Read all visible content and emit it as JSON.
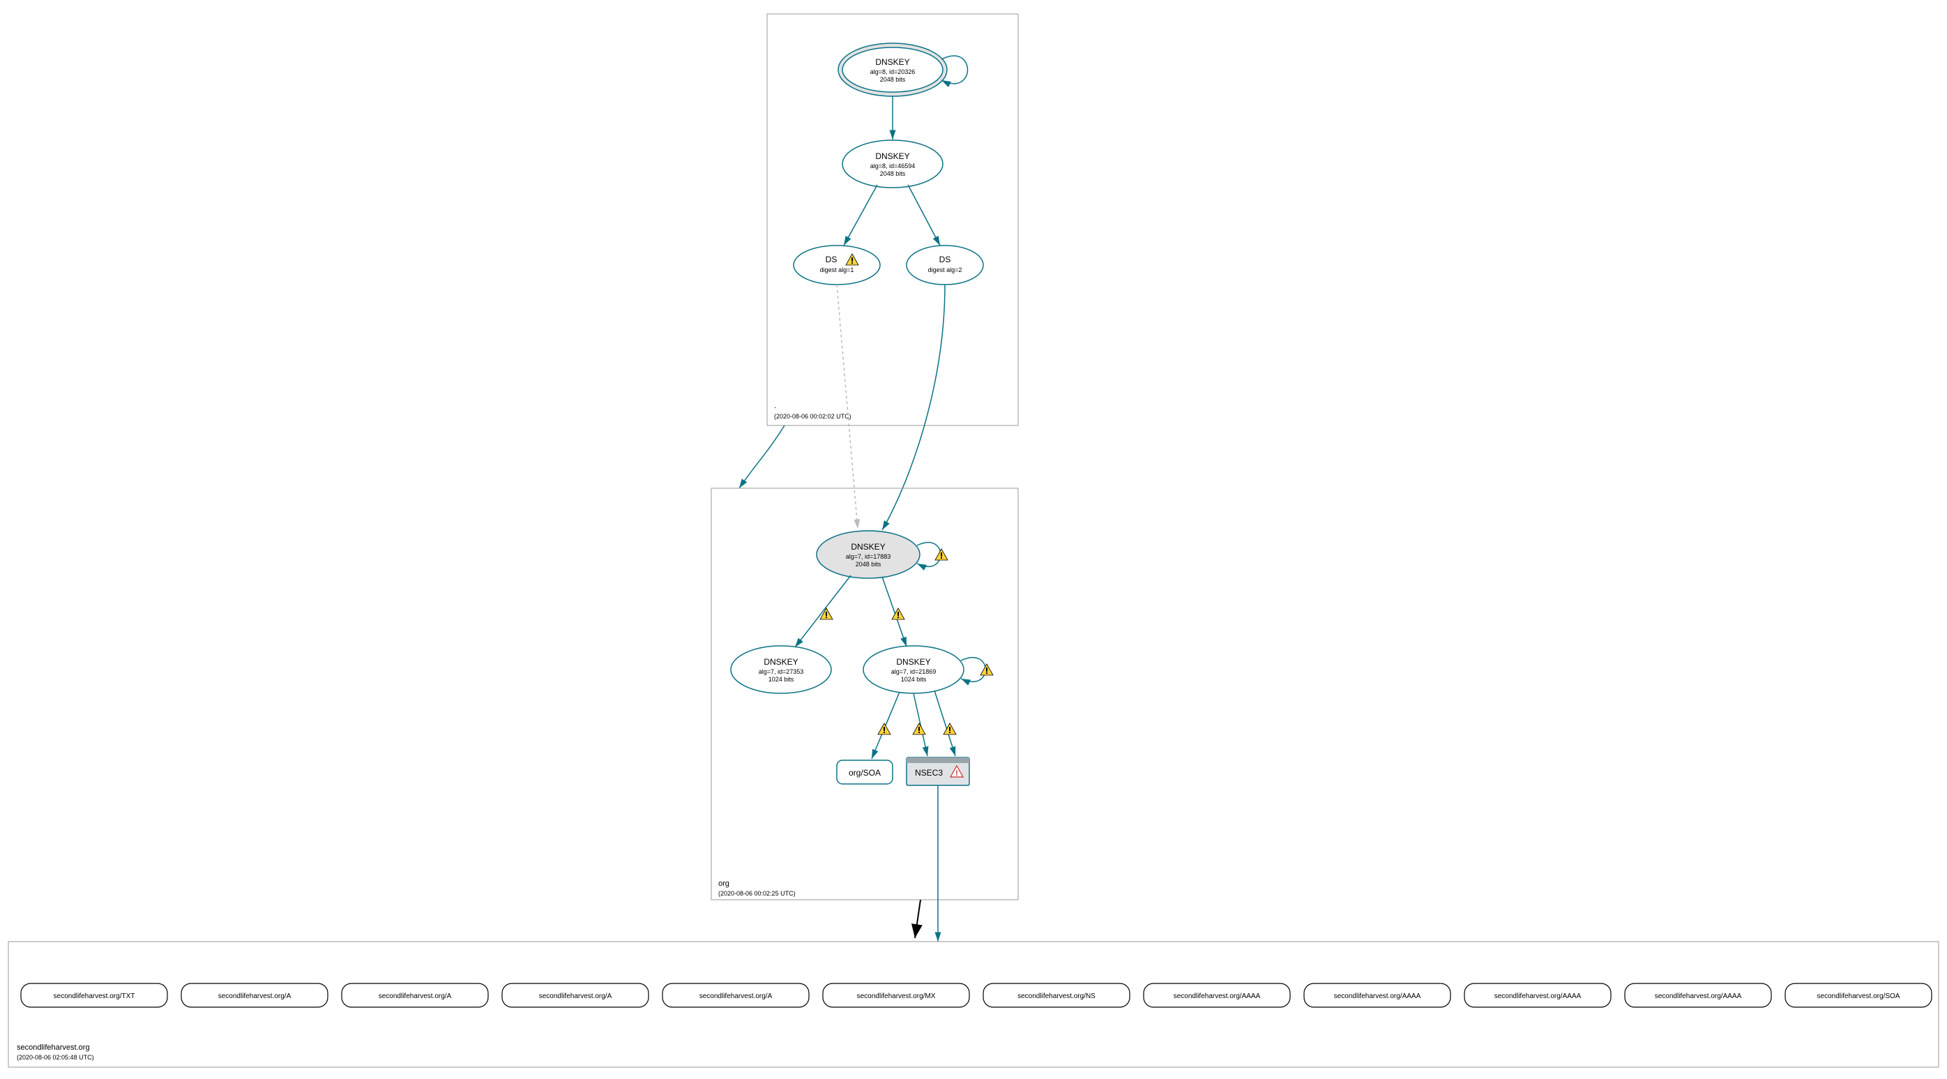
{
  "zones": {
    "root": {
      "name": ".",
      "timestamp": "(2020-08-06 00:02:02 UTC)"
    },
    "org": {
      "name": "org",
      "timestamp": "(2020-08-06 00:02:25 UTC)"
    },
    "slh": {
      "name": "secondlifeharvest.org",
      "timestamp": "(2020-08-06 02:05:48 UTC)"
    }
  },
  "nodes": {
    "root_ksk": {
      "title": "DNSKEY",
      "line2": "alg=8, id=20326",
      "line3": "2048 bits"
    },
    "root_zsk": {
      "title": "DNSKEY",
      "line2": "alg=8, id=46594",
      "line3": "2048 bits"
    },
    "ds1": {
      "title": "DS",
      "line2": "digest alg=1"
    },
    "ds2": {
      "title": "DS",
      "line2": "digest alg=2"
    },
    "org_ksk": {
      "title": "DNSKEY",
      "line2": "alg=7, id=17883",
      "line3": "2048 bits"
    },
    "org_zsk_a": {
      "title": "DNSKEY",
      "line2": "alg=7, id=27353",
      "line3": "1024 bits"
    },
    "org_zsk_b": {
      "title": "DNSKEY",
      "line2": "alg=7, id=21869",
      "line3": "1024 bits"
    },
    "org_soa": {
      "label": "org/SOA"
    },
    "nsec3": {
      "label": "NSEC3"
    }
  },
  "leaves": [
    "secondlifeharvest.org/TXT",
    "secondlifeharvest.org/A",
    "secondlifeharvest.org/A",
    "secondlifeharvest.org/A",
    "secondlifeharvest.org/A",
    "secondlifeharvest.org/MX",
    "secondlifeharvest.org/NS",
    "secondlifeharvest.org/AAAA",
    "secondlifeharvest.org/AAAA",
    "secondlifeharvest.org/AAAA",
    "secondlifeharvest.org/AAAA",
    "secondlifeharvest.org/SOA"
  ],
  "icons": {
    "warn": "warning-icon",
    "err": "error-icon"
  }
}
